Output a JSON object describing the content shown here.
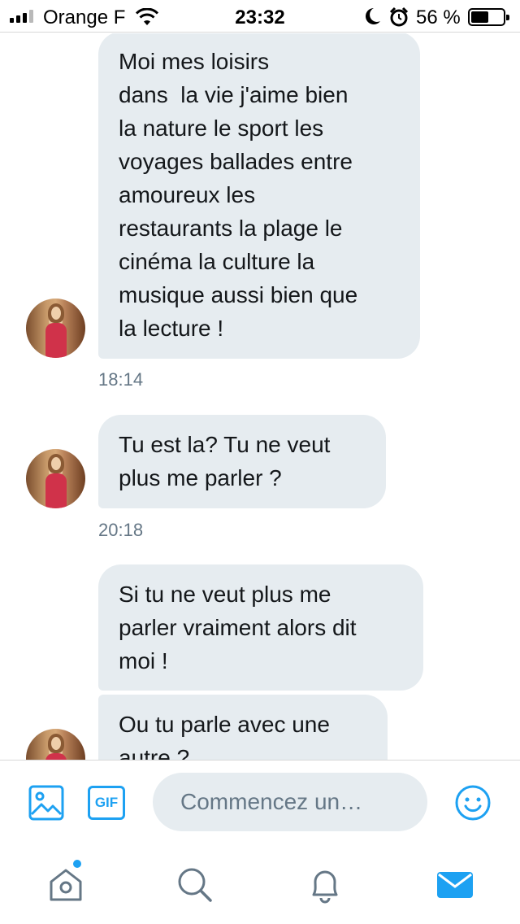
{
  "status_bar": {
    "carrier": "Orange F",
    "time": "23:32",
    "battery_percent": "56 %",
    "battery_level": 0.56
  },
  "messages": [
    {
      "text": "Moi mes loisirs\ndans  la vie j'aime bien\nla nature le sport les\nvoyages ballades entre\namoureux les\nrestaurants la plage le\ncinéma la culture la\nmusique aussi bien que\nla lecture !",
      "timestamp": "18:14"
    },
    {
      "text": "Tu est la? Tu ne veut\nplus me parler ?",
      "timestamp": "20:18"
    },
    {
      "text": "Si tu ne veut plus me\nparler vraiment alors dit\nmoi !",
      "timestamp": ""
    },
    {
      "text": "Ou tu parle avec une\nautre ?",
      "timestamp": ""
    }
  ],
  "composer": {
    "placeholder": "Commencez un…",
    "gif_label": "GIF",
    "icons": [
      "image-icon",
      "gif-icon",
      "emoji-icon"
    ]
  },
  "tabbar": {
    "items": [
      "home-icon",
      "search-icon",
      "notifications-icon",
      "messages-icon"
    ],
    "active": "messages-icon",
    "home_has_dot": true
  },
  "colors": {
    "accent": "#1da1f2",
    "bubble": "#e6ecf0",
    "secondary_text": "#657786"
  }
}
